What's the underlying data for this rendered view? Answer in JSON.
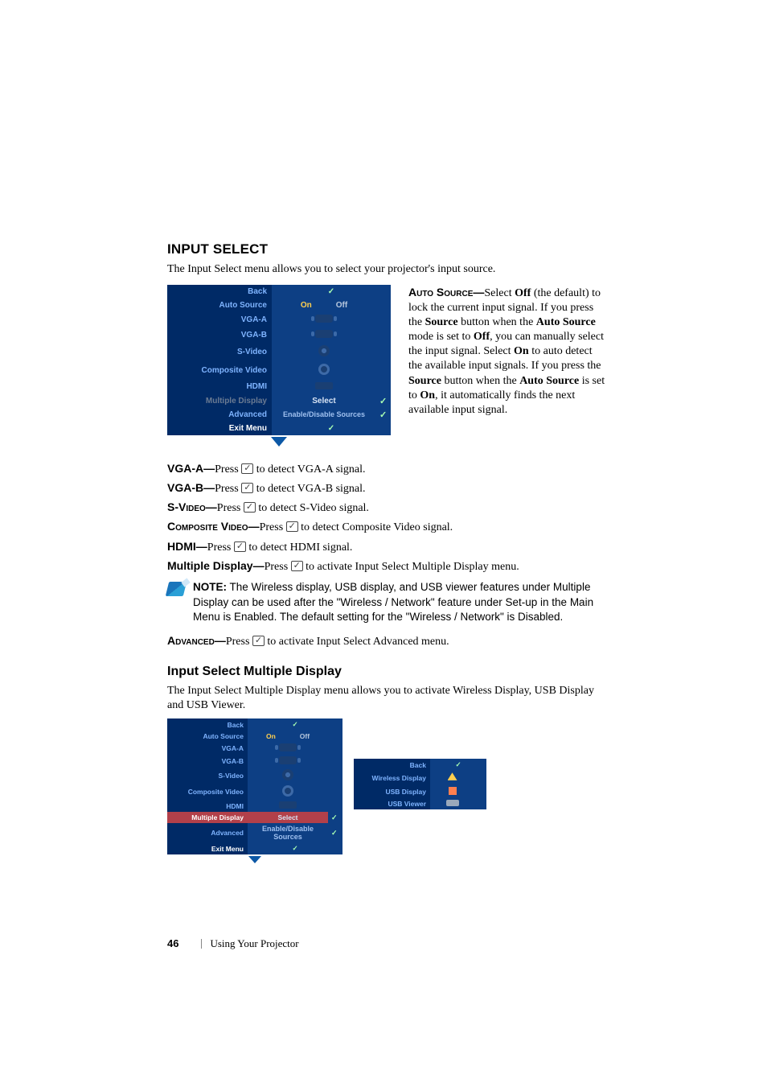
{
  "section": {
    "title": "INPUT SELECT",
    "intro": "The Input Select menu allows you to select your projector's input source."
  },
  "menu_main": {
    "rows": [
      {
        "label": "Back",
        "type": "check"
      },
      {
        "label": "Auto Source",
        "type": "onoff",
        "on": "On",
        "off": "Off"
      },
      {
        "label": "VGA-A",
        "type": "icon",
        "icon": "vga"
      },
      {
        "label": "VGA-B",
        "type": "icon",
        "icon": "vga"
      },
      {
        "label": "S-Video",
        "type": "icon",
        "icon": "sv"
      },
      {
        "label": "Composite Video",
        "type": "icon",
        "icon": "cv"
      },
      {
        "label": "HDMI",
        "type": "icon",
        "icon": "hdmi"
      },
      {
        "label": "Multiple Display",
        "type": "select",
        "text": "Select",
        "muted": true,
        "tick": true
      },
      {
        "label": "Advanced",
        "type": "enable",
        "text": "Enable/Disable Sources",
        "tick": true
      },
      {
        "label": "Exit Menu",
        "type": "check",
        "exit": true
      }
    ]
  },
  "auto_source_desc": {
    "label": "Auto Source—",
    "text": "Select Off (the default) to lock the current input signal. If you press the Source button when the Auto Source mode is set to Off, you can manually select the input signal. Select On to auto detect the available input signals. If you press the Source button when the Auto Source is set to On, it automatically finds the next available input signal.",
    "bold": {
      "off": "Off",
      "source": "Source",
      "auto_source": "Auto Source",
      "on": "On"
    }
  },
  "defs": [
    {
      "label": "VGA-A—",
      "text": "Press ",
      "after": " to detect VGA-A signal."
    },
    {
      "label": "VGA-B—",
      "text": "Press ",
      "after": " to detect VGA-B signal."
    },
    {
      "label": "S-Video—",
      "smallcaps": true,
      "text": "Press ",
      "after": " to detect S-Video signal."
    },
    {
      "label": "Composite Video—",
      "smallcaps": true,
      "text": "Press ",
      "after": " to detect Composite Video signal."
    },
    {
      "label": "HDMI—",
      "text": "Press ",
      "after": " to detect HDMI signal."
    },
    {
      "label": "Multiple Display—",
      "text": "Press ",
      "after": " to activate Input Select Multiple Display menu."
    }
  ],
  "note": {
    "label": "NOTE:",
    "text": " The Wireless display, USB display, and USB viewer features under Multiple Display can be used after the \"Wireless / Network\" feature under Set-up in the Main Menu is Enabled. The default setting for the \"Wireless / Network\" is Disabled."
  },
  "advanced_def": {
    "label": "Advanced—",
    "smallcaps": true,
    "text": "Press ",
    "after": " to activate Input Select Advanced menu."
  },
  "subsection": {
    "title": "Input Select Multiple Display",
    "intro": "The Input Select Multiple Display menu allows you to activate Wireless Display, USB Display and USB Viewer."
  },
  "menu_left": {
    "rows": [
      {
        "label": "Back",
        "type": "check"
      },
      {
        "label": "Auto Source",
        "type": "onoff",
        "on": "On",
        "off": "Off"
      },
      {
        "label": "VGA-A",
        "type": "icon",
        "icon": "vga"
      },
      {
        "label": "VGA-B",
        "type": "icon",
        "icon": "vga"
      },
      {
        "label": "S-Video",
        "type": "icon",
        "icon": "sv"
      },
      {
        "label": "Composite Video",
        "type": "icon",
        "icon": "cv"
      },
      {
        "label": "HDMI",
        "type": "icon",
        "icon": "hdmi"
      },
      {
        "label": "Multiple Display",
        "type": "select",
        "text": "Select",
        "highlight": true,
        "tick": true
      },
      {
        "label": "Advanced",
        "type": "enable",
        "text": "Enable/Disable Sources",
        "tick": true
      },
      {
        "label": "Exit Menu",
        "type": "check",
        "exit": true
      }
    ]
  },
  "menu_right": {
    "rows": [
      {
        "label": "Back",
        "type": "check"
      },
      {
        "label": "Wireless Display",
        "type": "ricon",
        "icon": "wifi"
      },
      {
        "label": "USB Display",
        "type": "ricon",
        "icon": "usb-sq"
      },
      {
        "label": "USB Viewer",
        "type": "ricon",
        "icon": "usb-rect"
      }
    ]
  },
  "footer": {
    "page": "46",
    "text": "Using Your Projector"
  }
}
